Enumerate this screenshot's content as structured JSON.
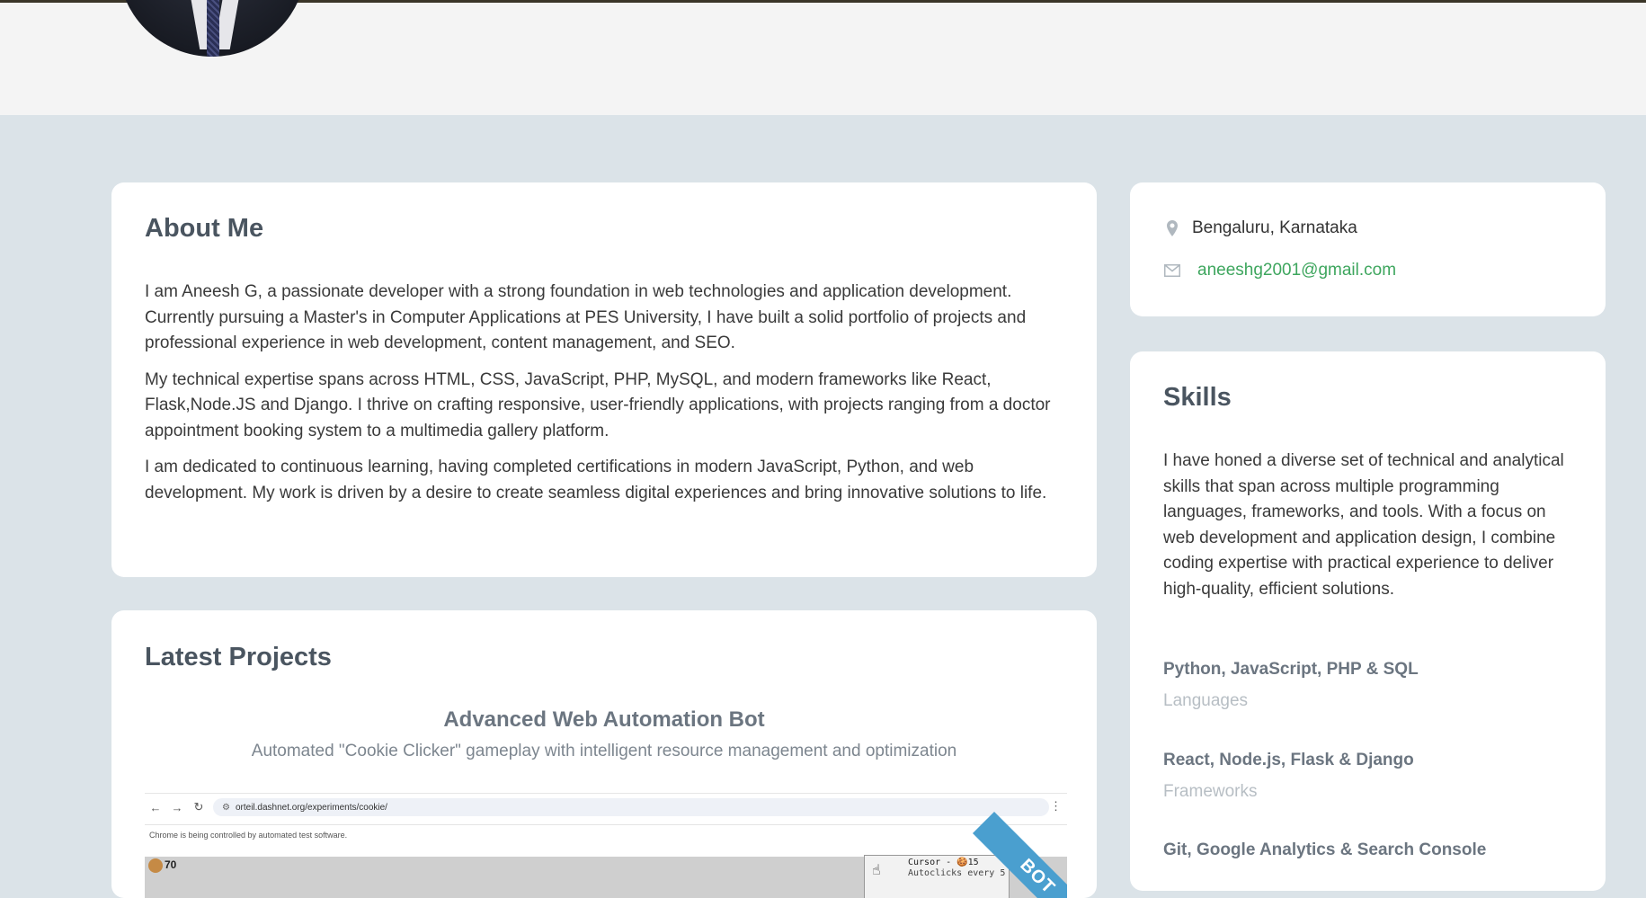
{
  "about": {
    "title": "About Me",
    "paragraphs": [
      "I am Aneesh G, a passionate developer with a strong foundation in web technologies and application development. Currently pursuing a Master's in Computer Applications at PES University, I have built a solid portfolio of projects and professional experience in web development, content management, and SEO.",
      "My technical expertise spans across HTML, CSS, JavaScript, PHP, MySQL, and modern frameworks like React, Flask,Node.JS and Django. I thrive on crafting responsive, user-friendly applications, with projects ranging from a doctor appointment booking system to a multimedia gallery platform.",
      "I am dedicated to continuous learning, having completed certifications in modern JavaScript, Python, and web development. My work is driven by a desire to create seamless digital experiences and bring innovative solutions to life."
    ]
  },
  "projects": {
    "title": "Latest Projects",
    "featured": {
      "title": "Advanced Web Automation Bot",
      "subtitle": "Automated \"Cookie Clicker\" gameplay with intelligent resource management and optimization",
      "ribbon": "BOT",
      "screenshot": {
        "url": "orteil.dashnet.org/experiments/cookie/",
        "automation_notice": "Chrome is being controlled by automated test software.",
        "cookie_count": "70",
        "store_line1": "Cursor - 🍪15",
        "store_line2": "Autoclicks every 5"
      }
    }
  },
  "contact": {
    "location": "Bengaluru, Karnataka",
    "email": "aneeshg2001@gmail.com",
    "icons": [
      "map-marker-icon",
      "envelope-icon"
    ],
    "email_color": "#3ea65e"
  },
  "skills": {
    "title": "Skills",
    "intro": "I have honed a diverse set of technical and analytical skills that span across multiple programming languages, frameworks, and tools. With a focus on web development and application design, I combine coding expertise with practical experience to deliver high-quality, efficient solutions.",
    "items": [
      {
        "name": "Python, JavaScript, PHP & SQL",
        "category": "Languages"
      },
      {
        "name": "React, Node.js, Flask & Django",
        "category": "Frameworks"
      },
      {
        "name": "Git, Google Analytics & Search Console",
        "category": ""
      }
    ]
  }
}
